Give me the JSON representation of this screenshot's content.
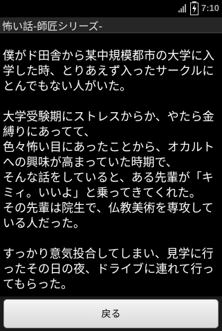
{
  "status_bar": {
    "time": "7:10",
    "icons": [
      "signal-icon",
      "battery-charging-icon"
    ]
  },
  "title_bar": {
    "title": "怖い話-師匠シリーズ-"
  },
  "content": {
    "paragraphs": [
      "僕がド田舎から某中規模都市の大学に入学した時、とりあえず入ったサークルにとんでもない人がいた。",
      "大学受験期にストレスからか、やたら金縛りにあってて、\n色々怖い目にあったことから、オカルトへの興味が高まっていた時期で、\nそんな話をしていると、ある先輩が「キミィ。いいよ」と乗ってきてくれた。\nその先輩は院生で、仏教美術を専攻している人だった。",
      "すっかり意気投合してしまい、見学に行ったその日の夜、ドライブに連れて行ってもらった。"
    ]
  },
  "bottom_bar": {
    "back_label": "戻る"
  },
  "colors": {
    "background": "#000000",
    "title_bar": "#262626",
    "text": "#ffffff",
    "button": "#e6e6e6"
  }
}
